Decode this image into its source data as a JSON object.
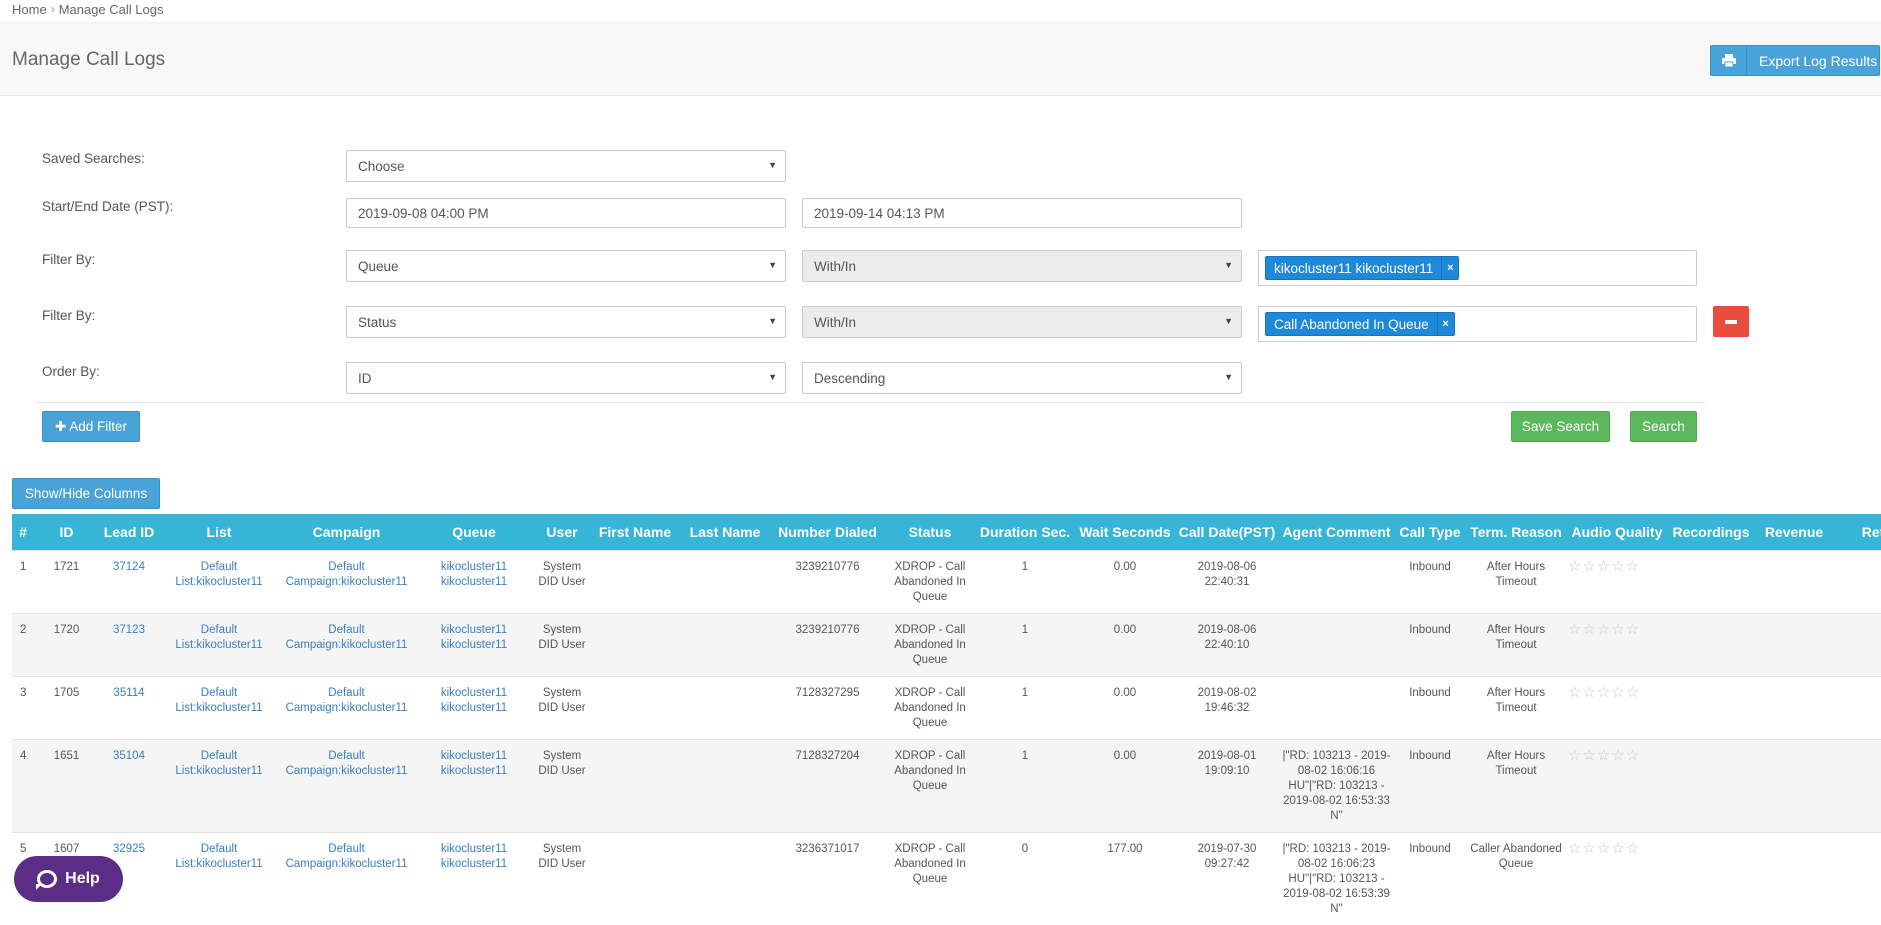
{
  "breadcrumb": {
    "home": "Home",
    "sep": "›",
    "current": "Manage Call Logs"
  },
  "header": {
    "title": "Manage Call Logs",
    "export_label": "Export Log Results",
    "export_icon": "printer-icon"
  },
  "form": {
    "saved_searches_label": "Saved Searches:",
    "saved_searches_value": "Choose",
    "date_label": "Start/End Date (PST):",
    "start_date": "2019-09-08 04:00 PM",
    "end_date": "2019-09-14 04:13 PM",
    "filter_label": "Filter By:",
    "filter1": {
      "field": "Queue",
      "operator": "With/In",
      "tag": "kikocluster11 kikocluster11"
    },
    "filter2": {
      "field": "Status",
      "operator": "With/In",
      "tag": "Call Abandoned In Queue"
    },
    "order_label": "Order By:",
    "order_field": "ID",
    "order_dir": "Descending",
    "add_filter_label": "✚ Add Filter",
    "save_search_label": "Save Search",
    "search_label": "Search",
    "tag_remove": "×"
  },
  "table": {
    "toggle_label": "Show/Hide Columns",
    "columns": [
      "#",
      "ID",
      "Lead ID",
      "List",
      "Campaign",
      "Queue",
      "User",
      "First Name",
      "Last Name",
      "Number Dialed",
      "Status",
      "Duration Sec.",
      "Wait Seconds",
      "Call Date(PST)",
      "Agent Comment",
      "Call Type",
      "Term. Reason",
      "Audio Quality",
      "Recordings",
      "Revenue",
      "Returned"
    ],
    "rows": [
      {
        "n": "1",
        "id": "1721",
        "lead": "37124",
        "list": "Default List:kikocluster11",
        "campaign": "Default Campaign:kikocluster11",
        "queue": "kikocluster11 kikocluster11",
        "user": "System DID User",
        "first": "",
        "last": "",
        "number": "3239210776",
        "status": "XDROP - Call Abandoned In Queue",
        "duration": "1",
        "wait": "0.00",
        "date": "2019-08-06 22:40:31",
        "comment": "",
        "type": "Inbound",
        "term": "After Hours Timeout",
        "audio": "☆☆☆☆☆",
        "recordings": "",
        "revenue": "",
        "returned": ""
      },
      {
        "n": "2",
        "id": "1720",
        "lead": "37123",
        "list": "Default List:kikocluster11",
        "campaign": "Default Campaign:kikocluster11",
        "queue": "kikocluster11 kikocluster11",
        "user": "System DID User",
        "first": "",
        "last": "",
        "number": "3239210776",
        "status": "XDROP - Call Abandoned In Queue",
        "duration": "1",
        "wait": "0.00",
        "date": "2019-08-06 22:40:10",
        "comment": "",
        "type": "Inbound",
        "term": "After Hours Timeout",
        "audio": "☆☆☆☆☆",
        "recordings": "",
        "revenue": "",
        "returned": ""
      },
      {
        "n": "3",
        "id": "1705",
        "lead": "35114",
        "list": "Default List:kikocluster11",
        "campaign": "Default Campaign:kikocluster11",
        "queue": "kikocluster11 kikocluster11",
        "user": "System DID User",
        "first": "",
        "last": "",
        "number": "7128327295",
        "status": "XDROP - Call Abandoned In Queue",
        "duration": "1",
        "wait": "0.00",
        "date": "2019-08-02 19:46:32",
        "comment": "",
        "type": "Inbound",
        "term": "After Hours Timeout",
        "audio": "☆☆☆☆☆",
        "recordings": "",
        "revenue": "",
        "returned": ""
      },
      {
        "n": "4",
        "id": "1651",
        "lead": "35104",
        "list": "Default List:kikocluster11",
        "campaign": "Default Campaign:kikocluster11",
        "queue": "kikocluster11 kikocluster11",
        "user": "System DID User",
        "first": "",
        "last": "",
        "number": "7128327204",
        "status": "XDROP - Call Abandoned In Queue",
        "duration": "1",
        "wait": "0.00",
        "date": "2019-08-01 19:09:10",
        "comment": "|\"RD: 103213 - 2019-08-02 16:06:16 HU\"|\"RD: 103213 - 2019-08-02 16:53:33 N\"",
        "type": "Inbound",
        "term": "After Hours Timeout",
        "audio": "☆☆☆☆☆",
        "recordings": "",
        "revenue": "",
        "returned": ""
      },
      {
        "n": "5",
        "id": "1607",
        "lead": "32925",
        "list": "Default List:kikocluster11",
        "campaign": "Default Campaign:kikocluster11",
        "queue": "kikocluster11 kikocluster11",
        "user": "System DID User",
        "first": "",
        "last": "",
        "number": "3236371017",
        "status": "XDROP - Call Abandoned In Queue",
        "duration": "0",
        "wait": "177.00",
        "date": "2019-07-30 09:27:42",
        "comment": "|\"RD: 103213 - 2019-08-02 16:06:23 HU\"|\"RD: 103213 - 2019-08-02 16:53:39 N\"",
        "type": "Inbound",
        "term": "Caller Abandoned Queue",
        "audio": "☆☆☆☆☆",
        "recordings": "",
        "revenue": "",
        "returned": ""
      }
    ]
  },
  "help": {
    "label": "Help",
    "icon": "chat-bubble-icon"
  },
  "colors": {
    "accent": "#37b5d6",
    "button_blue": "#4aa3d8",
    "green": "#5cb85c",
    "danger": "#e74c3c",
    "tag": "#1e88d9",
    "help": "#5b2d86"
  }
}
